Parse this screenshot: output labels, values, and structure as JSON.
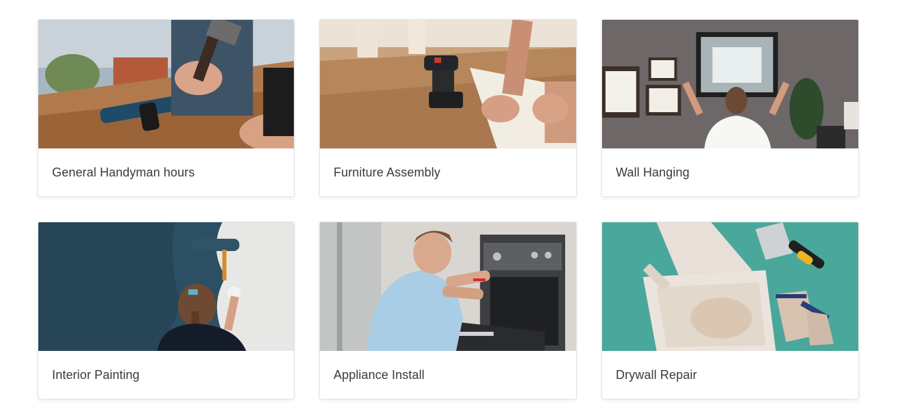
{
  "services": [
    {
      "title": "General Handyman hours",
      "image": "handyman-hammer-drill-photo"
    },
    {
      "title": "Furniture Assembly",
      "image": "cordless-drill-furniture-photo"
    },
    {
      "title": "Wall Hanging",
      "image": "woman-hanging-frame-photo"
    },
    {
      "title": "Interior Painting",
      "image": "woman-painting-wall-photo"
    },
    {
      "title": "Appliance Install",
      "image": "man-installing-oven-photo"
    },
    {
      "title": "Drywall Repair",
      "image": "drywall-tools-photo"
    }
  ]
}
